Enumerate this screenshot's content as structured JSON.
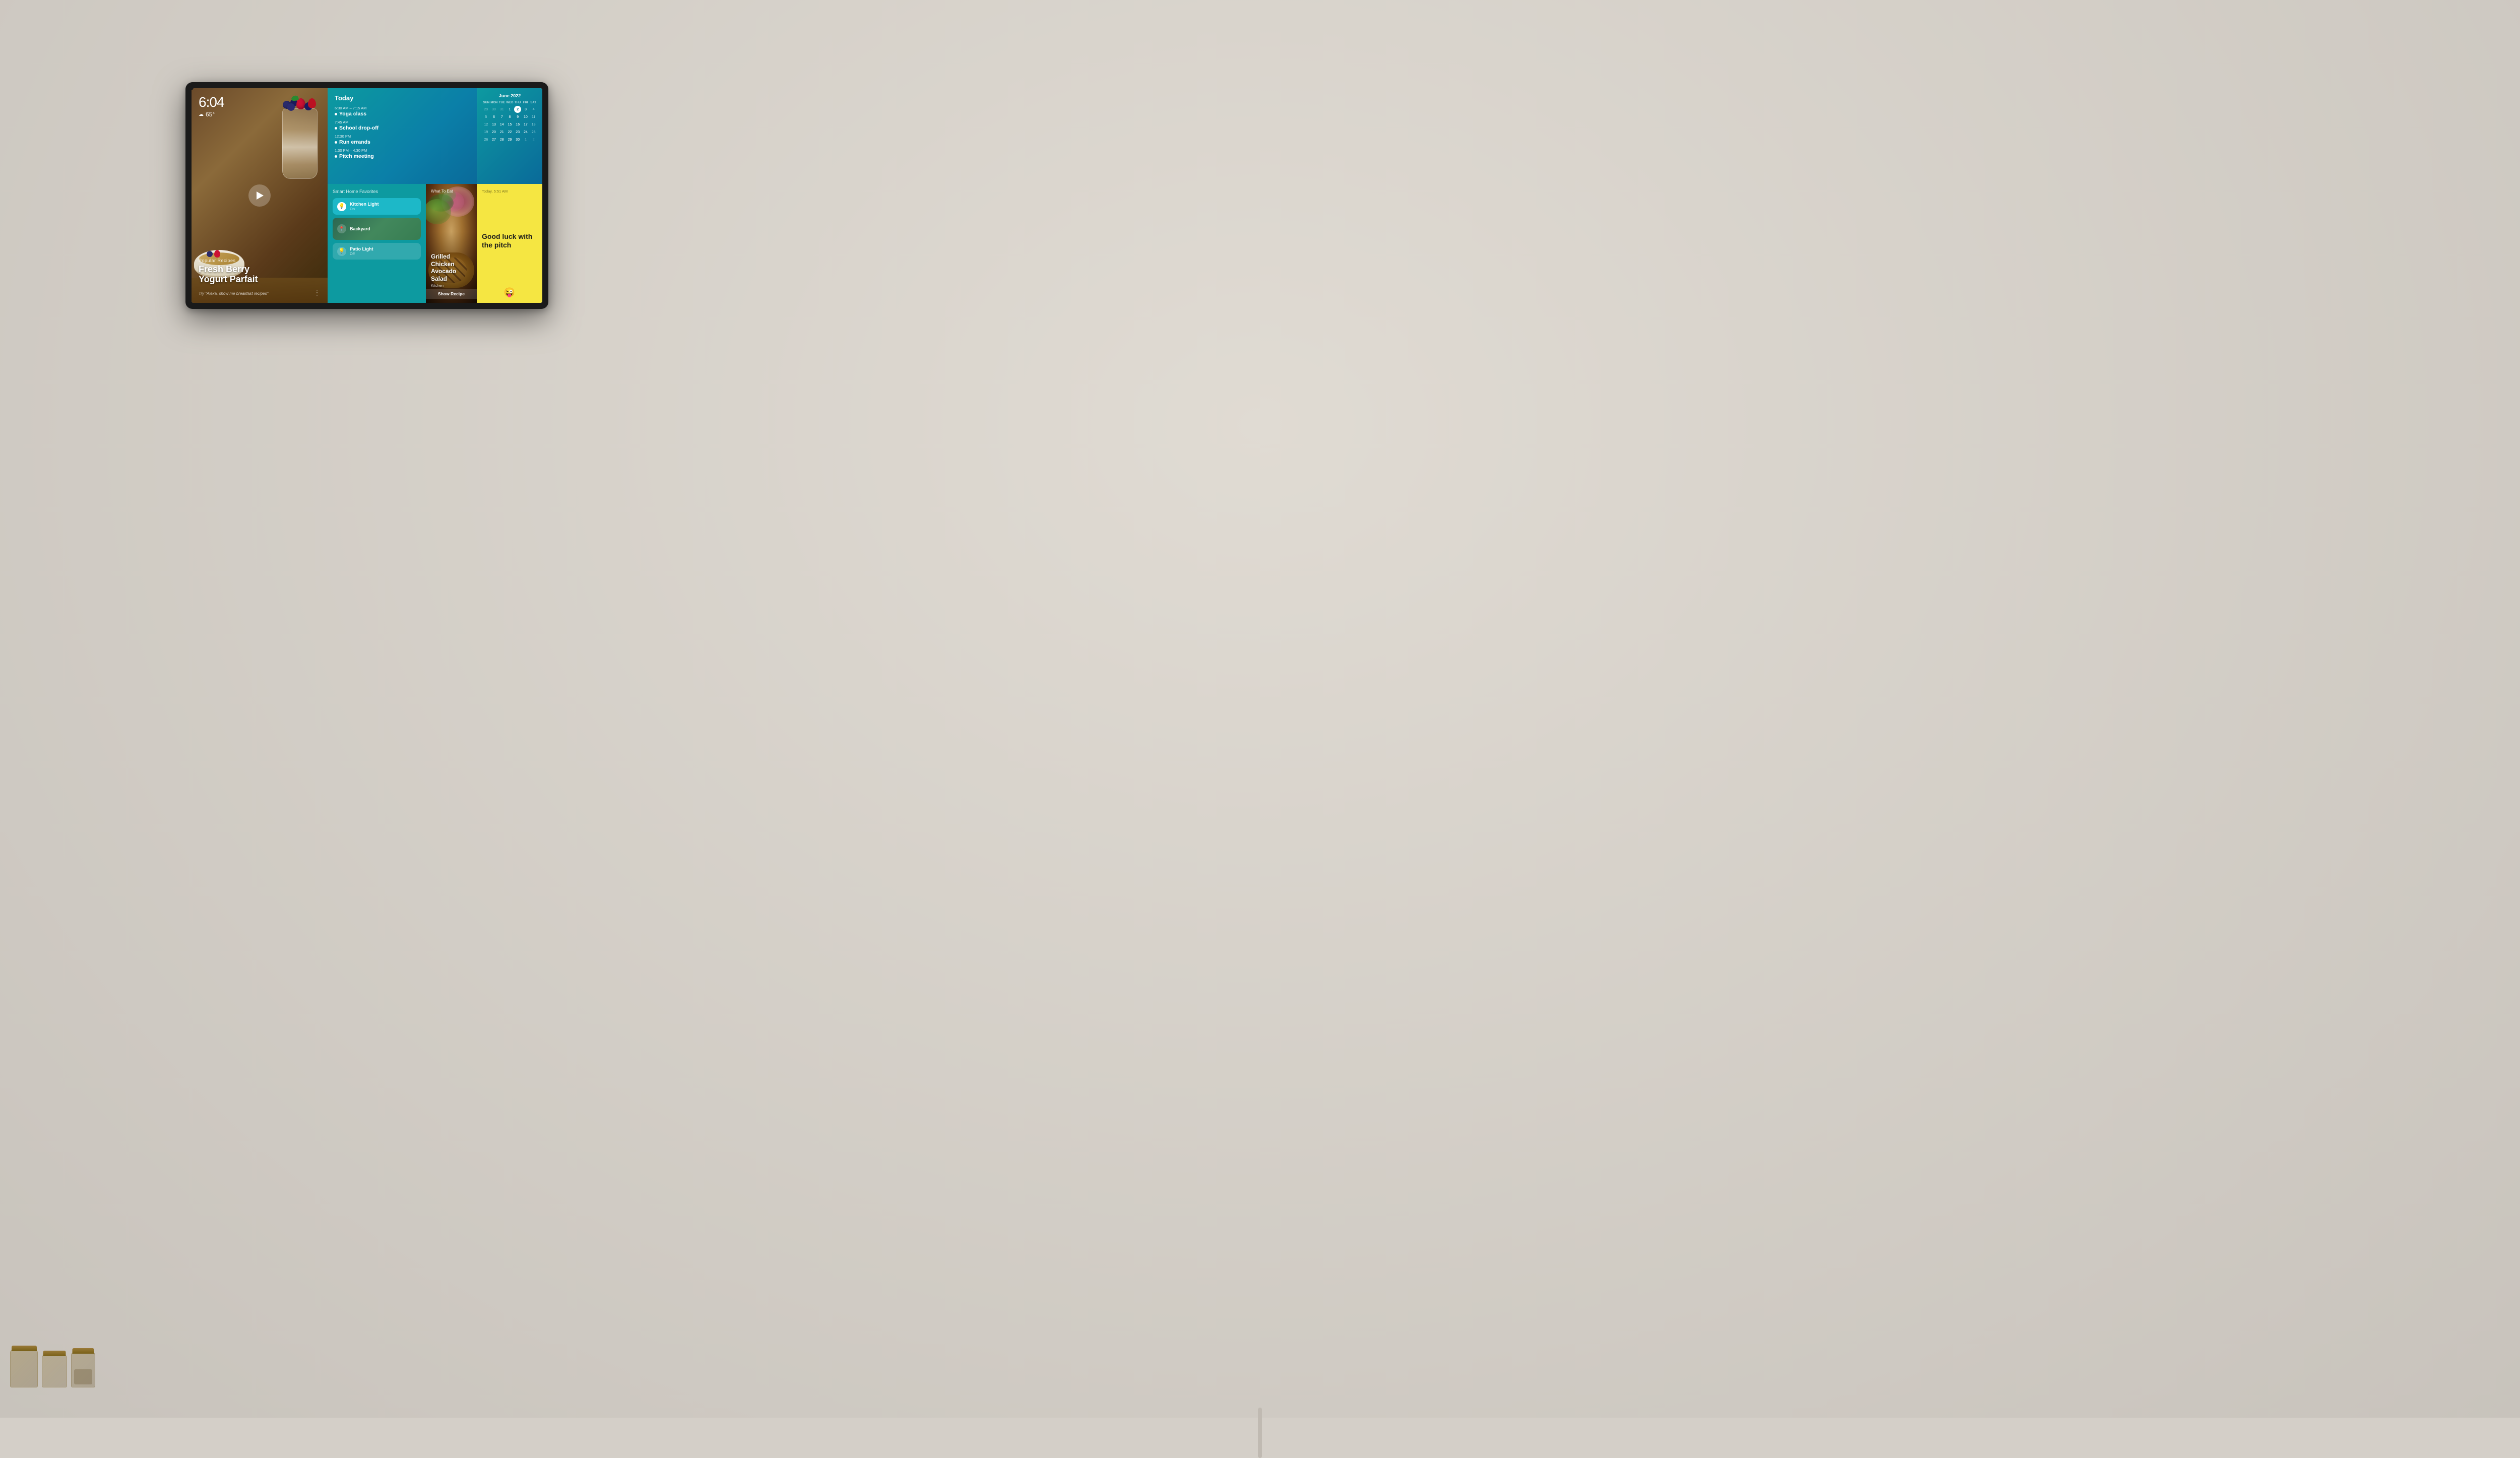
{
  "device": {
    "frame_label": "Amazon Echo Show",
    "camera_dot_label": "camera"
  },
  "screen": {
    "time": "6:04",
    "weather_icon": "☁",
    "temperature": "65°",
    "recipe_section": {
      "category": "Popular Recipes",
      "name_line1": "Fresh Berry",
      "name_line2": "Yogurt Parfait",
      "prompt": "Try \"Alexa, show me breakfast recipes\""
    },
    "schedule": {
      "title": "Today",
      "events": [
        {
          "time": "6:30 AM – 7:15 AM",
          "name": "Yoga class"
        },
        {
          "time": "7:45 AM",
          "name": "School drop-off"
        },
        {
          "time": "12:30 PM",
          "name": "Run errands"
        },
        {
          "time": "1:30 PM – 4:30 PM",
          "name": "Pitch meeting"
        }
      ]
    },
    "calendar": {
      "month_year": "June 2022",
      "day_names": [
        "SUN",
        "MON",
        "TUE",
        "WED",
        "THU",
        "FRI",
        "SAT"
      ],
      "weeks": [
        [
          "29",
          "30",
          "31",
          "1",
          "2",
          "3",
          "4"
        ],
        [
          "5",
          "6",
          "7",
          "8",
          "9",
          "10",
          "11"
        ],
        [
          "12",
          "13",
          "14",
          "15",
          "16",
          "17",
          "18"
        ],
        [
          "19",
          "20",
          "21",
          "22",
          "23",
          "24",
          "25"
        ],
        [
          "26",
          "27",
          "28",
          "29",
          "30",
          "1",
          "2"
        ]
      ],
      "today": "2",
      "today_week": 0,
      "today_col": 4
    },
    "smart_home": {
      "title": "Smart Home Favorites",
      "devices": [
        {
          "name": "Kitchen Light",
          "status": "On",
          "active": true,
          "icon": "💡"
        },
        {
          "name": "Backyard",
          "status": "",
          "active": false,
          "icon": "📍"
        },
        {
          "name": "Patio Light",
          "status": "Off",
          "active": false,
          "icon": "💡"
        }
      ]
    },
    "food": {
      "label": "What To Eat",
      "name_line1": "Grilled Chicken",
      "name_line2": "Avocado Salad",
      "sub": "Kitchen",
      "show_recipe": "Show Recipe"
    },
    "note": {
      "time": "Today, 5:51 AM",
      "text": "Good luck with the pitch",
      "emoji": "😜"
    }
  }
}
